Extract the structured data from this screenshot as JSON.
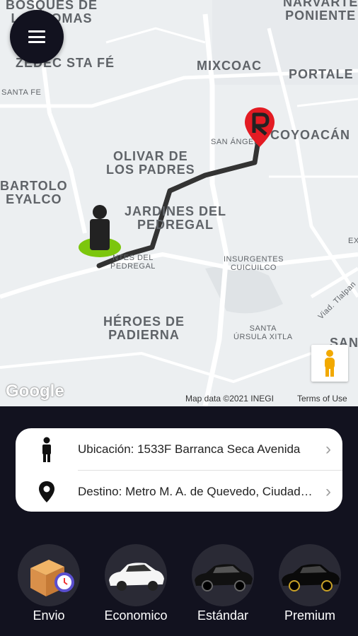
{
  "map": {
    "labels": {
      "bosques": "BOSQUES DE\nLAS LOMAS",
      "zedec": "ZEDEC STA FÉ",
      "santa_fe": "SANTA FE",
      "mixcoac": "MIXCOAC",
      "narvarte": "NARVARTE\nPONIENTE",
      "portales": "PORTALE",
      "san_angel": "SAN ÁNGEL",
      "coyoacan": "COYOACÁN",
      "olivar": "OLIVAR DE\nLOS PADRES",
      "bartolo": "BARTOLO\nEYALCO",
      "jardines": "JARDINES DEL\nPEDREGAL",
      "fuentes": "NTES DEL\nPEDREGAL",
      "insurgentes": "INSURGENTES\nCUICUILCO",
      "heroes": "HÉROES DE\nPADIERNA",
      "santa_ursula": "SANTA\nÚRSULA XITLA",
      "viad": "Viad. Tlalpan",
      "san": "SAN",
      "ex": "EX"
    },
    "google_logo": "Google",
    "map_data": "Map data ©2021 INEGI",
    "terms": "Terms of Use"
  },
  "menu_icon": "hamburger-menu-icon",
  "pegman_icon": "street-view-pegman-icon",
  "addresses": {
    "origin": {
      "icon": "person-icon",
      "text": "Ubicación: 1533F Barranca Seca Avenida"
    },
    "destination": {
      "icon": "location-pin-icon",
      "text": "Destino: Metro M. A. de Quevedo, Ciudad de México"
    }
  },
  "services": [
    {
      "name": "Envio",
      "icon": "package-clock-icon"
    },
    {
      "name": "Economico",
      "icon": "white-car-icon"
    },
    {
      "name": "Estándar",
      "icon": "black-sedan-icon"
    },
    {
      "name": "Premium",
      "icon": "black-luxury-car-icon"
    }
  ],
  "colors": {
    "background": "#12121f",
    "route": "#333333",
    "pin": "#e31b23",
    "origin_marker": "#7cc60d"
  }
}
